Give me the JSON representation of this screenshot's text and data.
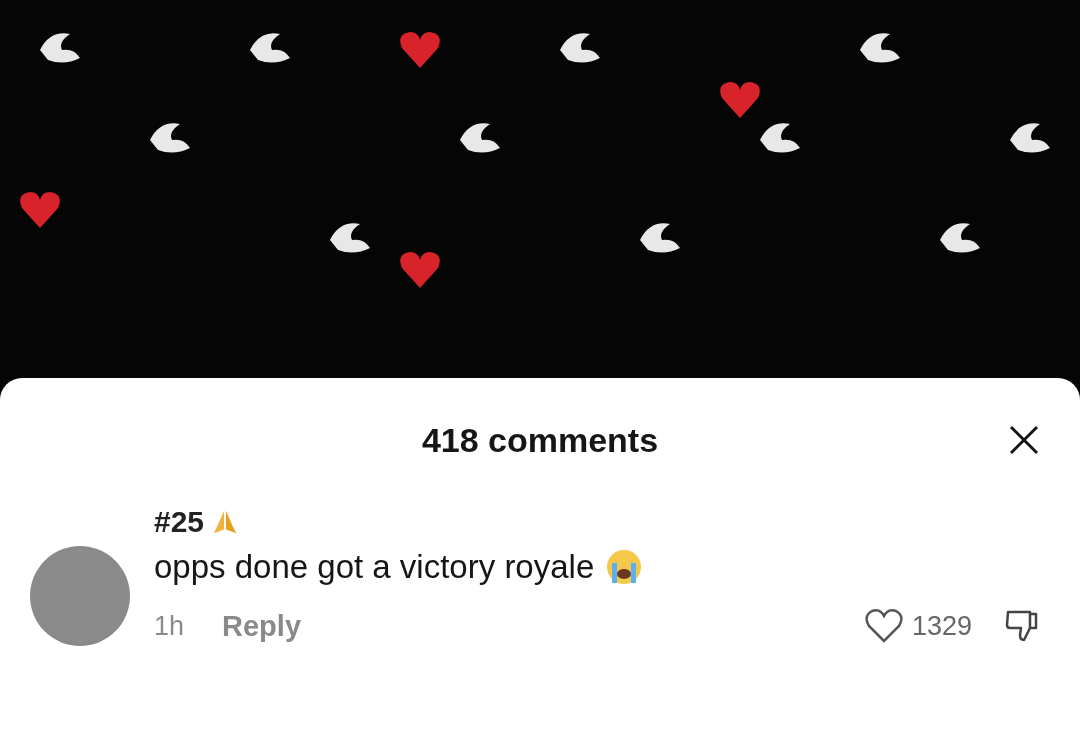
{
  "comments_panel": {
    "title": "418 comments"
  },
  "comments": [
    {
      "username": "#25",
      "text": "opps done got a victory royale",
      "time": "1h",
      "reply": "Reply",
      "likes": "1329"
    }
  ]
}
